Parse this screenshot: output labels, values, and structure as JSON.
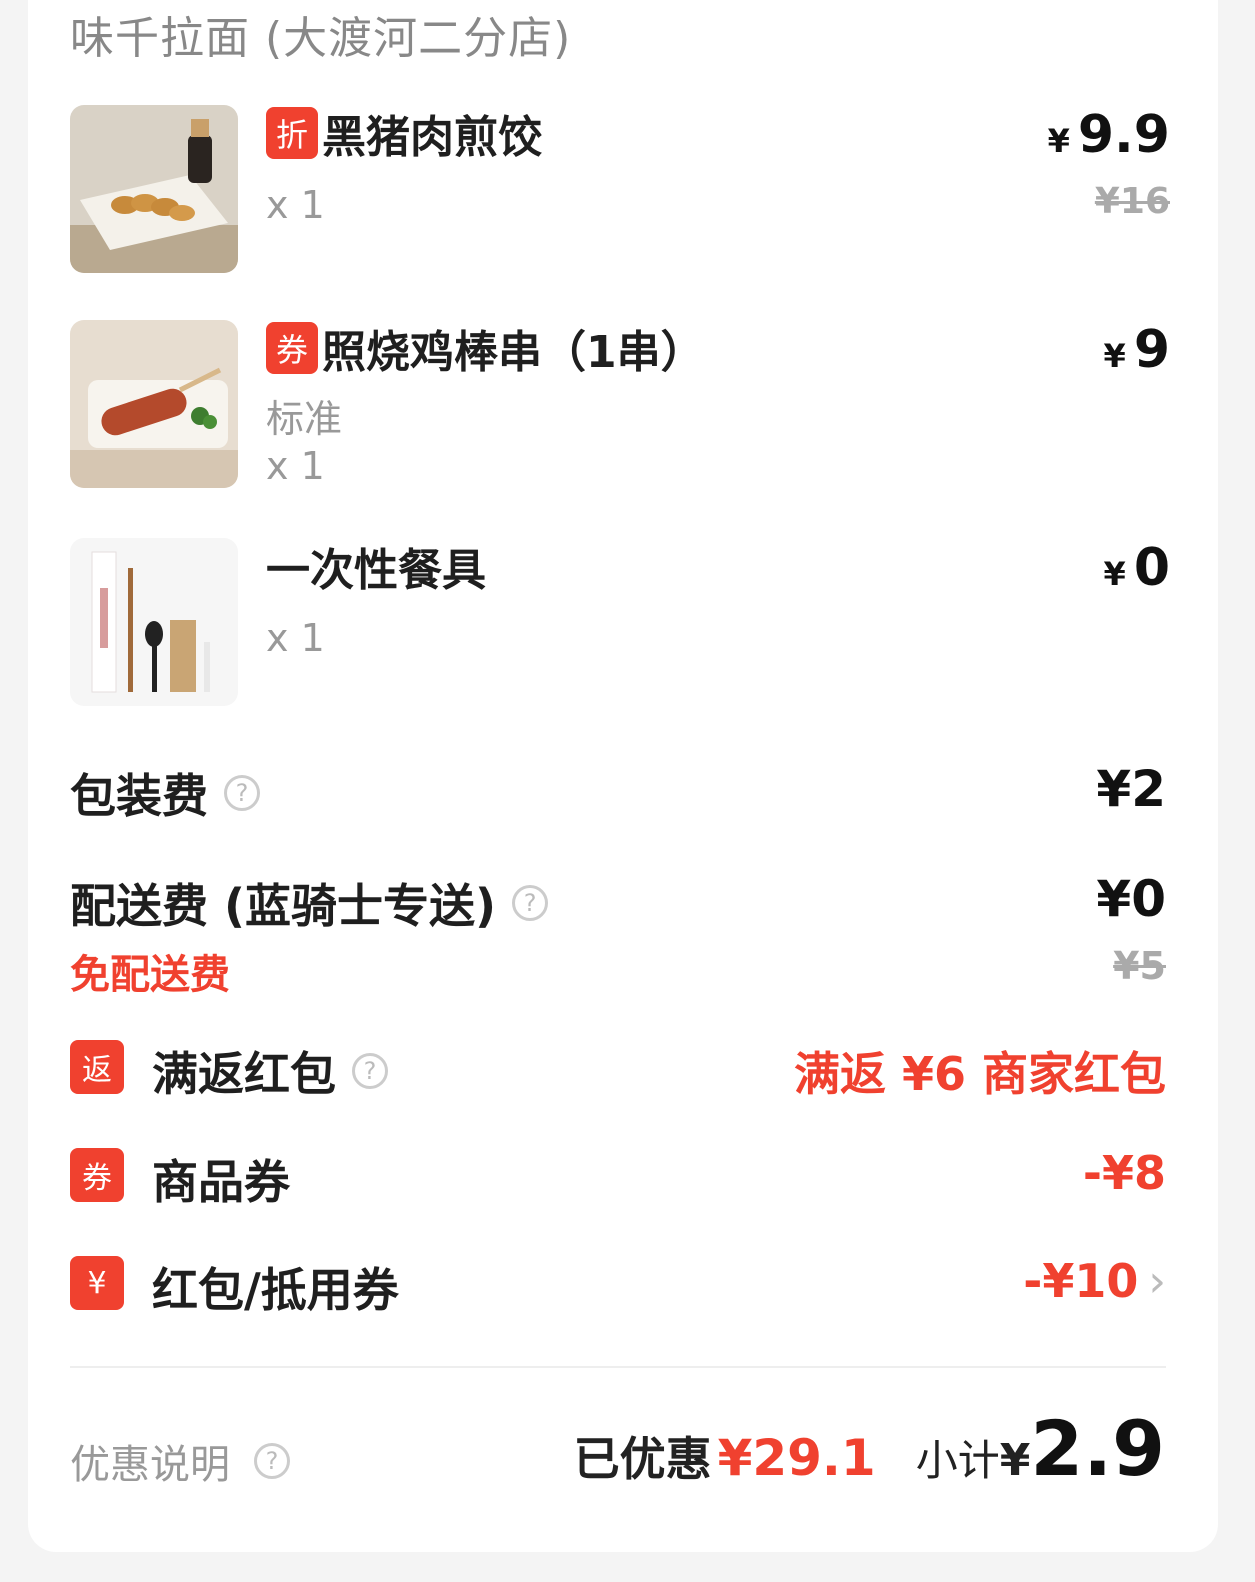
{
  "store": {
    "name": "味千拉面 (大渡河二分店)"
  },
  "items": [
    {
      "tag": "折",
      "name": "黑猪肉煎饺",
      "spec": "",
      "qty": "x 1",
      "price_yen": "¥",
      "price": "9.9",
      "original_price": "¥16"
    },
    {
      "tag": "券",
      "name": "照烧鸡棒串（1串）",
      "spec": "标准",
      "qty": "x 1",
      "price_yen": "¥",
      "price": "9",
      "original_price": ""
    },
    {
      "tag": "",
      "name": "一次性餐具",
      "spec": "",
      "qty": "x 1",
      "price_yen": "¥",
      "price": "0",
      "original_price": ""
    }
  ],
  "fees": {
    "packaging": {
      "label": "包装费",
      "value": "¥2"
    },
    "delivery": {
      "label": "配送费 (蓝骑士专送)",
      "value": "¥0",
      "note": "免配送费",
      "original": "¥5"
    }
  },
  "promos": [
    {
      "icon": "返",
      "label": "满返红包",
      "value": "满返 ¥6 商家红包"
    },
    {
      "icon": "券",
      "label": "商品券",
      "value": "-¥8"
    },
    {
      "icon": "¥",
      "label": "红包/抵用券",
      "value": "-¥10"
    }
  ],
  "footer": {
    "explain_label": "优惠说明",
    "saved_label": "已优惠",
    "saved_value": "¥29.1",
    "subtotal_label": "小计",
    "subtotal_yen": "¥",
    "subtotal_value": "2.9"
  },
  "colors": {
    "accent": "#f0412f",
    "muted": "#999999"
  }
}
